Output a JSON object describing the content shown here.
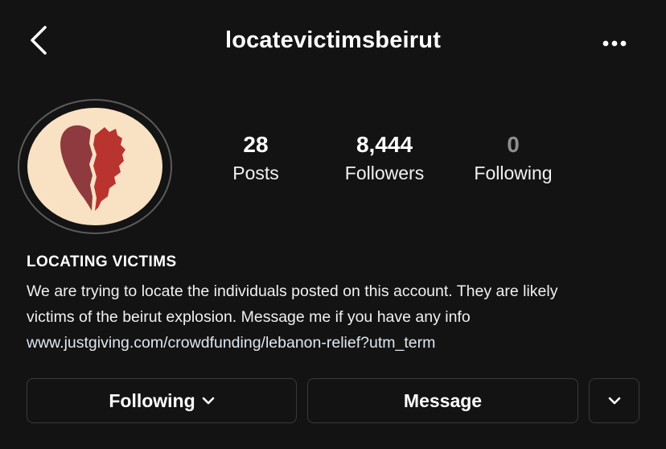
{
  "header": {
    "username": "locatevictimsbeirut",
    "back_icon": "chevron-left-icon",
    "more_icon": "more-horizontal-icon"
  },
  "profile": {
    "avatar_icon": "broken-heart-lebanon-icon",
    "avatar_colors": {
      "background": "#f8e2c3",
      "left_half": "#8f3a3f",
      "right_half": "#b9342f"
    },
    "stats": [
      {
        "value": "28",
        "label": "Posts"
      },
      {
        "value": "8,444",
        "label": "Followers"
      },
      {
        "value": "0",
        "label": "Following"
      }
    ]
  },
  "bio": {
    "name": "LOCATING VICTIMS",
    "line1": "We are trying to locate the individuals posted on this account. They are likely",
    "line2": "victims of the beirut explosion. Message me if you have any info",
    "link": "www.justgiving.com/crowdfunding/lebanon-relief?utm_term"
  },
  "actions": {
    "following_label": "Following",
    "message_label": "Message",
    "following_icon": "chevron-down-icon",
    "more_icon": "chevron-down-icon"
  }
}
